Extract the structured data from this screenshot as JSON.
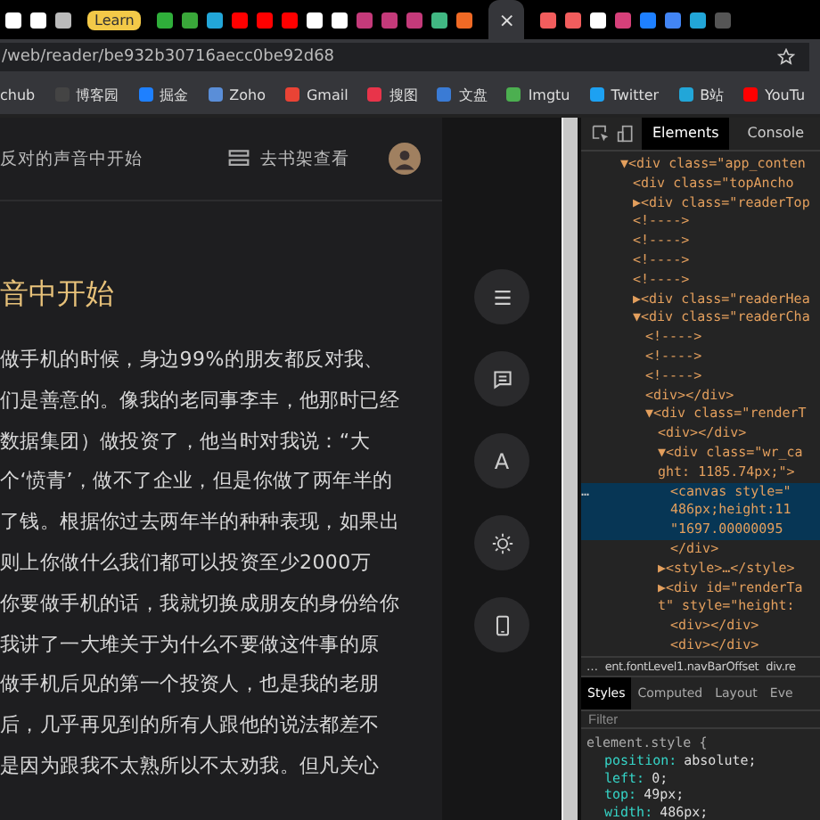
{
  "tab_strip": {
    "favicons": [
      {
        "color": "#ffffff"
      },
      {
        "color": "#ffffff"
      },
      {
        "color": "#bbbbbb"
      }
    ],
    "group": {
      "label": "Learn"
    },
    "group_favicons": [
      {
        "color": "#2fae3a"
      },
      {
        "color": "#3aa83a"
      },
      {
        "color": "#22a6d8"
      },
      {
        "color": "#ff0000"
      },
      {
        "color": "#ff0000"
      },
      {
        "color": "#ff0000"
      },
      {
        "color": "#ffffff"
      },
      {
        "color": "#ffffff"
      },
      {
        "color": "#c43a7a"
      },
      {
        "color": "#c43a7a"
      },
      {
        "color": "#c43a7a"
      },
      {
        "color": "#41b883"
      },
      {
        "color": "#f06a25"
      }
    ],
    "active_tab": {
      "close": "×"
    },
    "after_favicons": [
      {
        "color": "#f25d5d"
      },
      {
        "color": "#f25d5d"
      },
      {
        "color": "#ffffff"
      },
      {
        "color": "#d6407a"
      },
      {
        "color": "#1e80ff"
      },
      {
        "color": "#4285f4"
      },
      {
        "color": "#22a6d8"
      },
      {
        "color": "#555555"
      }
    ]
  },
  "address_bar": {
    "url": "/web/reader/be932b30716aecc0be92d68"
  },
  "bookmarks": [
    {
      "label": "chub"
    },
    {
      "label": "博客园",
      "color": "#444444"
    },
    {
      "label": "掘金",
      "color": "#1e80ff"
    },
    {
      "label": "Zoho",
      "color": "#5a8ed8"
    },
    {
      "label": "Gmail",
      "color": "#ea4335"
    },
    {
      "label": "搜图",
      "color": "#e8344a"
    },
    {
      "label": "文盘",
      "color": "#3a7bd5"
    },
    {
      "label": "Imgtu",
      "color": "#4caf50"
    },
    {
      "label": "Twitter",
      "color": "#1da1f2"
    },
    {
      "label": "B站",
      "color": "#22a6d8"
    },
    {
      "label": "YouTu",
      "color": "#ff0000"
    }
  ],
  "reader": {
    "header_title": "反对的声音中开始",
    "shelf_link": "去书架查看",
    "chapter_title": "音中开始",
    "paragraph_lines": [
      "做手机的时候，身边99%的朋友都反对我、",
      "们是善意的。像我的老同事李丰，他那时已经",
      "数据集团）做投资了，他当时对我说：“大",
      "个‘愤青’，做不了企业，但是你做了两年半的",
      "了钱。根据你过去两年半的种种表现，如果出",
      "则上你做什么我们都可以投资至少2000万",
      "你要做手机的话，我就切换成朋友的身份给你",
      "我讲了一大堆关于为什么不要做这件事的原",
      "做手机后见的第一个投资人，也是我的老朋",
      "后，几乎再见到的所有人跟他的说法都差不",
      "是因为跟我不太熟所以不太劝我。但凡关心"
    ],
    "side_buttons": [
      {
        "kind": "menu"
      },
      {
        "kind": "comment"
      },
      {
        "kind": "font",
        "label": "A"
      },
      {
        "kind": "brightness"
      },
      {
        "kind": "phone"
      }
    ]
  },
  "devtools": {
    "tabs": [
      {
        "label": "Elements",
        "selected": true
      },
      {
        "label": "Console",
        "selected": false
      }
    ],
    "dom_tree": [
      {
        "lines": [
          "▼<div class=\"app_conten"
        ],
        "selected": false,
        "children": [
          {
            "lines": [
              "<div class=\"topAncho"
            ],
            "selected": false
          },
          {
            "lines": [
              "▶<div class=\"readerTop"
            ],
            "selected": false
          },
          {
            "lines": [
              "<!---->"
            ],
            "selected": false
          },
          {
            "lines": [
              "<!---->"
            ],
            "selected": false
          },
          {
            "lines": [
              "<!---->"
            ],
            "selected": false
          },
          {
            "lines": [
              "<!---->"
            ],
            "selected": false
          },
          {
            "lines": [
              "▶<div class=\"readerHea"
            ],
            "selected": false
          },
          {
            "lines": [
              "▼<div class=\"readerCha"
            ],
            "selected": false,
            "children": [
              {
                "lines": [
                  "<!---->"
                ],
                "selected": false
              },
              {
                "lines": [
                  "<!---->"
                ],
                "selected": false
              },
              {
                "lines": [
                  "<!---->"
                ],
                "selected": false
              },
              {
                "lines": [
                  "<div></div>"
                ],
                "selected": false
              },
              {
                "lines": [
                  "▼<div class=\"renderT"
                ],
                "selected": false,
                "children": [
                  {
                    "lines": [
                      "<div></div>"
                    ],
                    "selected": false
                  },
                  {
                    "lines": [
                      "▼<div class=\"wr_ca",
                      "ght: 1185.74px;\">"
                    ],
                    "selected": false,
                    "children": [
                      {
                        "lines": [
                          "<canvas style=\"",
                          "486px;height:11",
                          "\"1697.00000095"
                        ],
                        "selected": true
                      },
                      {
                        "lines": [
                          "</div>"
                        ],
                        "selected": false
                      }
                    ]
                  },
                  {
                    "lines": [
                      "▶<style>…</style>"
                    ],
                    "selected": false
                  },
                  {
                    "lines": [
                      "▶<div id=\"renderTa",
                      "t\" style=\"height: "
                    ],
                    "selected": false,
                    "children": [
                      {
                        "lines": [
                          "<div></div>"
                        ],
                        "selected": false
                      },
                      {
                        "lines": [
                          "<div></div>"
                        ],
                        "selected": false
                      }
                    ]
                  }
                ]
              }
            ]
          }
        ]
      }
    ],
    "selected_marker": "…",
    "breadcrumbs": {
      "more": "…",
      "items": [
        "ent.fontLevel1.navBarOffset",
        "div.re"
      ]
    },
    "style_tabs": [
      {
        "label": "Styles",
        "selected": true
      },
      {
        "label": "Computed",
        "selected": false
      },
      {
        "label": "Layout",
        "selected": false
      },
      {
        "label": "Eve",
        "selected": false
      }
    ],
    "filter_placeholder": "Filter",
    "rule_selector": "element.style {",
    "declarations": [
      {
        "property": "position:",
        "value": "absolute;"
      },
      {
        "property": "left:",
        "value": "0;"
      },
      {
        "property": "top:",
        "value": "49px;"
      },
      {
        "property": "width:",
        "value": "486px;"
      }
    ]
  }
}
